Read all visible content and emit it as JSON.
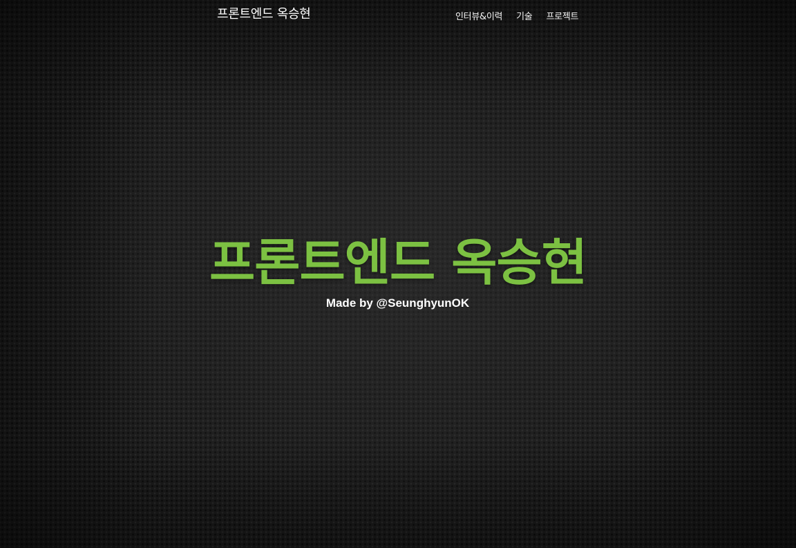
{
  "navbar": {
    "brand": "프론트엔드 옥승현",
    "links": [
      {
        "label": "인터뷰&이력"
      },
      {
        "label": "기술"
      },
      {
        "label": "프로젝트"
      }
    ]
  },
  "hero": {
    "title": "프론트엔드 옥승현",
    "subtitle": "Made by @SeunghyunOK"
  },
  "colors": {
    "background": "#1c1c1c",
    "accent_green": "#7cc142",
    "text": "#ffffff"
  }
}
